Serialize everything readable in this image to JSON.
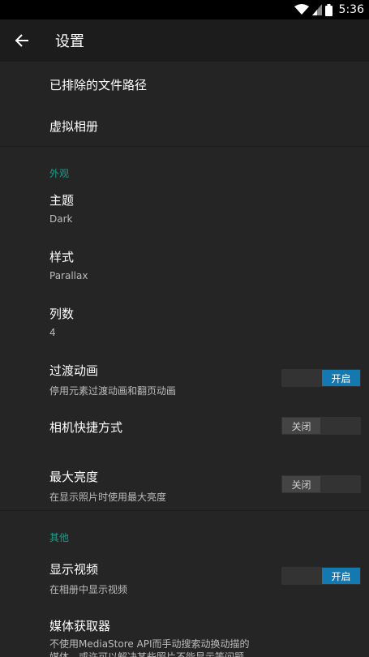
{
  "status": {
    "time": "5:36"
  },
  "toolbar": {
    "title": "设置"
  },
  "top_items": [
    {
      "label": "已排除的文件路径"
    },
    {
      "label": "虚拟相册"
    }
  ],
  "appearance": {
    "header": "外观",
    "theme": {
      "label": "主题",
      "value": "Dark"
    },
    "style": {
      "label": "样式",
      "value": "Parallax"
    },
    "columns": {
      "label": "列数",
      "value": "4"
    },
    "transitions": {
      "label": "过渡动画",
      "sub": "停用元素过渡动画和翻页动画",
      "toggle": "开启"
    },
    "camera": {
      "label": "相机快捷方式",
      "toggle": "关闭"
    },
    "brightness": {
      "label": "最大亮度",
      "sub": "在显示照片时使用最大亮度",
      "toggle": "关闭"
    }
  },
  "other": {
    "header": "其他",
    "video": {
      "label": "显示视频",
      "sub": "在相册中显示视频",
      "toggle": "开启"
    },
    "media_retriever": {
      "label": "媒体获取器",
      "sub": "不使用MediaStore API而手动搜索动换动描的媒体，或许可以解决某些照片不能显示等问题"
    }
  },
  "colors": {
    "accent": "#1d9c8c",
    "toggle_on": "#1479b0",
    "background": "#252525"
  }
}
